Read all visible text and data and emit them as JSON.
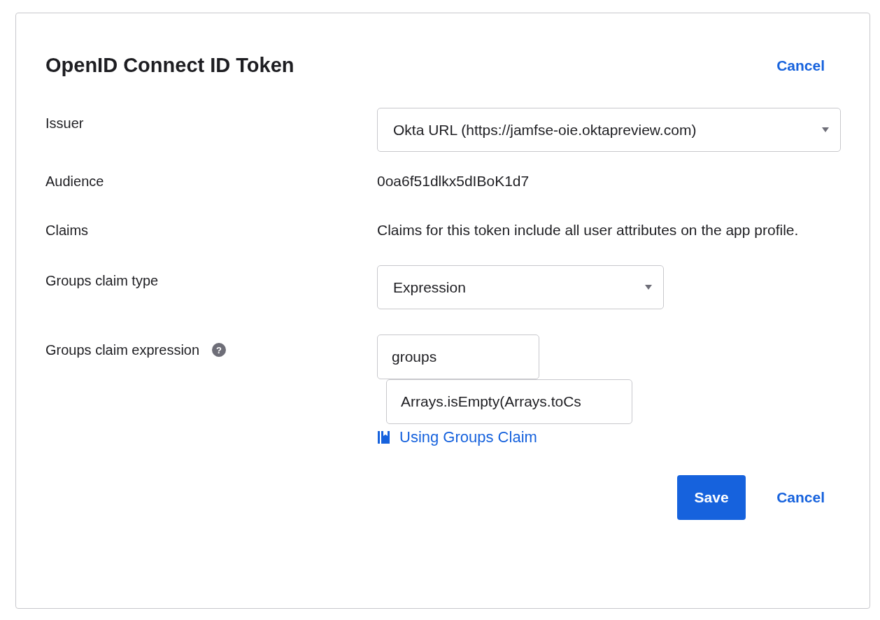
{
  "dialog": {
    "title": "OpenID Connect ID Token",
    "header_link": "Cancel"
  },
  "fields": [
    {
      "kind": "select",
      "label": "Issuer",
      "value": "Okta URL (https://jamfse-oie.oktapreview.com)",
      "wide": true
    },
    {
      "kind": "text",
      "label": "Audience",
      "value": "0oa6f51dlkx5dIBoK1d7"
    },
    {
      "kind": "text",
      "label": "Claims",
      "value": "Claims for this token include all user attributes on the app profile."
    },
    {
      "kind": "select",
      "label": "Groups claim type",
      "value": "Expression",
      "wide": false
    },
    {
      "kind": "expression",
      "label": "Groups claim expression",
      "help": "?",
      "name_value": "groups",
      "expression_value": "Arrays.isEmpty(Arrays.toCs",
      "link": "Using Groups Claim"
    }
  ],
  "footer": {
    "primary": "Save",
    "secondary": "Cancel"
  }
}
